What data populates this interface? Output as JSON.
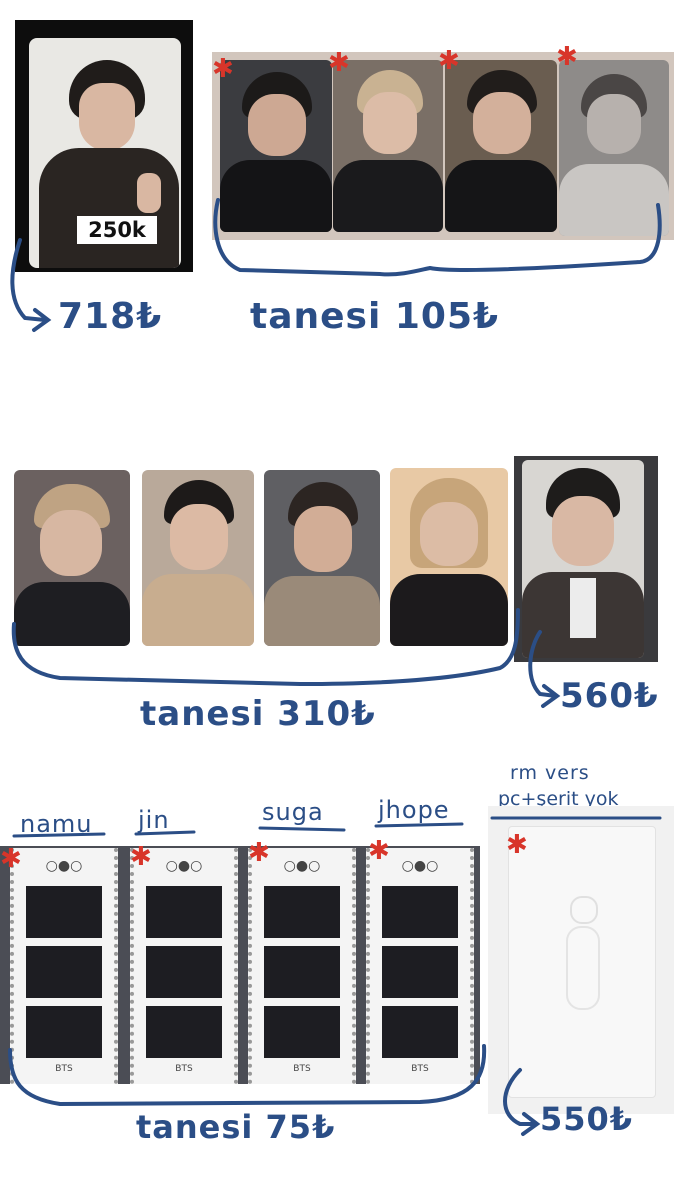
{
  "section1": {
    "badge": "250k",
    "single_price": "718₺",
    "group_price": "tanesi 105₺"
  },
  "section2": {
    "group_price": "tanesi 310₺",
    "single_price": "560₺"
  },
  "section3": {
    "labels": [
      "namu",
      "jin",
      "suga",
      "jhope"
    ],
    "strip_brand": "BTS",
    "group_price": "tanesi 75₺",
    "rm_note_line1": "rm vers",
    "rm_note_line2": "pc+şerit yok",
    "rm_price": "550₺"
  },
  "colors": {
    "ink": "#2b4e86",
    "star": "#d8352a"
  }
}
